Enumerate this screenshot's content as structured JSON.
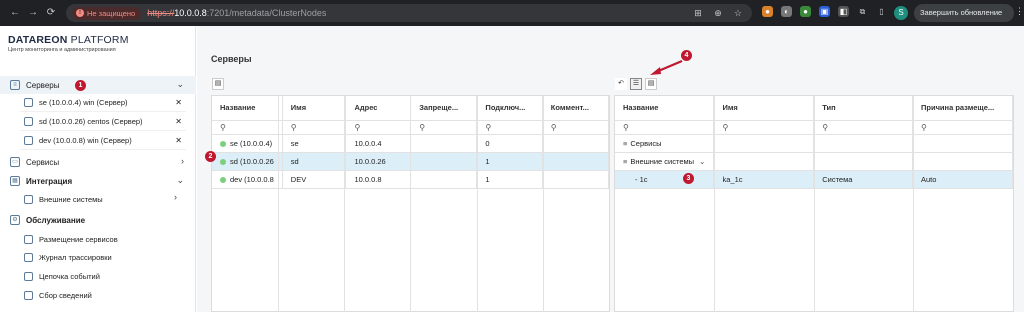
{
  "browser": {
    "insecure_label": "Не защищено",
    "url_scheme": "https://",
    "url_host": "10.0.0.8",
    "url_path": ":7201/metadata/ClusterNodes",
    "profile_initial": "S",
    "update_label": "Завершить обновление"
  },
  "brand": {
    "name_bold": "DATAREON",
    "name_light": " PLATFORM",
    "subtitle": "Центр мониторинга и администрирования"
  },
  "sidebar": {
    "servers_label": "Серверы",
    "server_items": [
      "se (10.0.0.4) win (Сервер)",
      "sd (10.0.0.26) centos (Сервер)",
      "dev (10.0.0.8) win (Сервер)"
    ],
    "services_label": "Сервисы",
    "integration_label": "Интеграция",
    "external_systems_label": "Внешние системы",
    "maintenance_label": "Обслуживание",
    "maintenance_items": [
      "Размещение сервисов",
      "Журнал трассировки",
      "Цепочка событий",
      "Сбор сведений"
    ]
  },
  "main": {
    "title": "Серверы",
    "left_table": {
      "columns": [
        "Название",
        "Имя",
        "Адрес",
        "Запреще...",
        "Подключ...",
        "Коммент..."
      ],
      "rows": [
        [
          "se (10.0.0.4)",
          "se",
          "10.0.0.4",
          "",
          "0",
          ""
        ],
        [
          "sd (10.0.0.26",
          "sd",
          "10.0.0.26",
          "",
          "1",
          ""
        ],
        [
          "dev (10.0.0.8",
          "DEV",
          "10.0.0.8",
          "",
          "1",
          ""
        ]
      ]
    },
    "right_table": {
      "columns": [
        "Название",
        "Имя",
        "Тип",
        "Причина размеще..."
      ],
      "rows": [
        [
          "Сервисы",
          "",
          "",
          ""
        ],
        [
          "Внешние системы",
          "",
          "",
          ""
        ],
        [
          "- 1c",
          "ka_1c",
          "Система",
          "Auto"
        ]
      ]
    }
  },
  "badges": [
    "1",
    "2",
    "3",
    "4"
  ],
  "colors": {
    "accent": "#c0182f",
    "selected_row": "#dceef7",
    "status_online": "#7ccf7c"
  }
}
